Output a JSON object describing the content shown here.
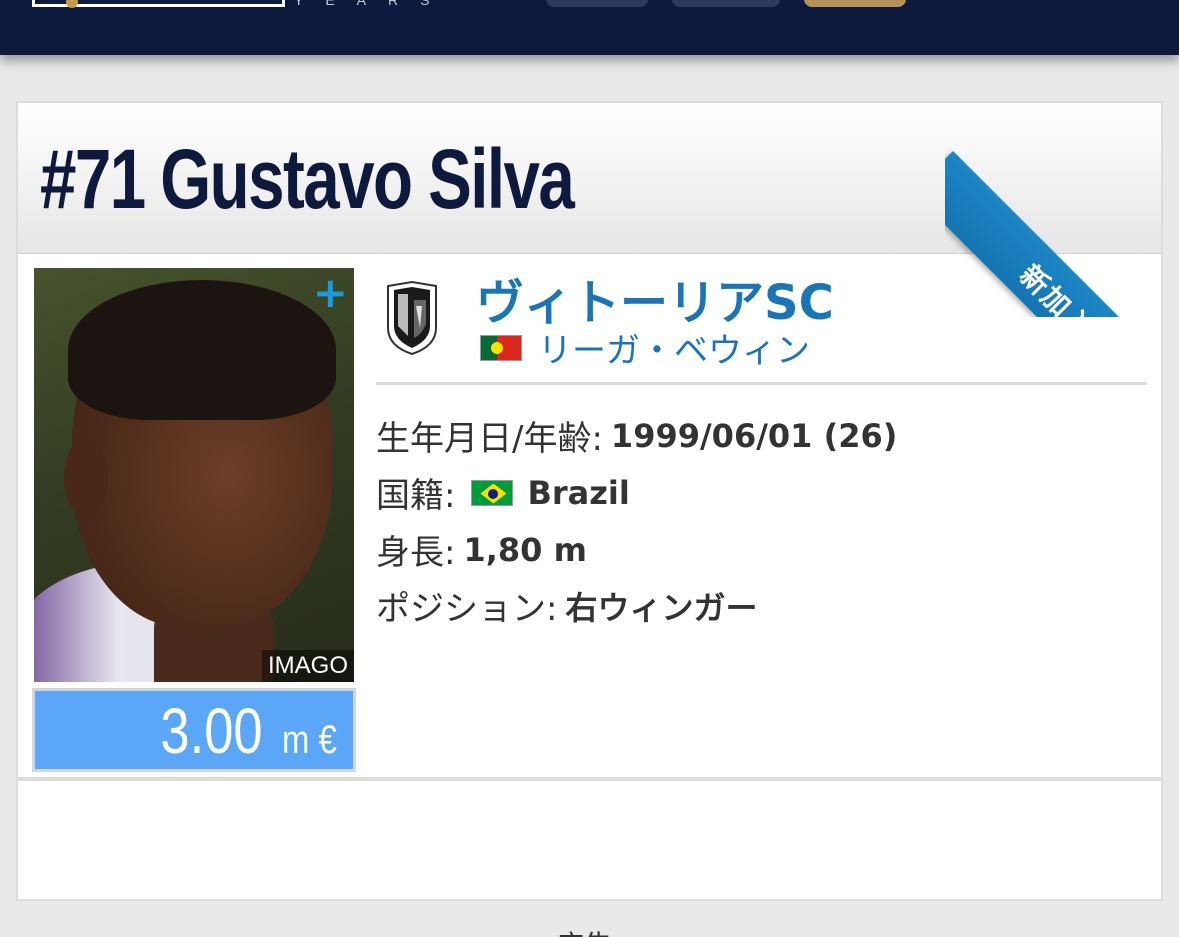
{
  "header": {
    "logo_years": "YEARS",
    "brand_gold": "#b59358",
    "brand_navy": "#0d1a3d"
  },
  "player": {
    "number": "#71",
    "name": "Gustavo Silva",
    "badge": "新加入",
    "photo_credit": "IMAGO",
    "photo_plus": "+",
    "market_value": "3.00",
    "market_value_unit": "m €"
  },
  "club": {
    "name": "ヴィトーリアSC",
    "league": "リーガ・ベウィン",
    "league_flag": "portugal-flag"
  },
  "details": {
    "birth_label": "生年月日/年齢:",
    "birth_value": "1999/06/01 (26)",
    "nationality_label": "国籍:",
    "nationality_flag": "brazil-flag",
    "nationality_value": "Brazil",
    "height_label": "身長:",
    "height_value": "1,80 m",
    "position_label": "ポジション:",
    "position_value": "右ウィンガー"
  },
  "footer": {
    "ad_label": "広告"
  },
  "colors": {
    "accent_blue": "#1a75b7",
    "ribbon_blue": "#1e86c6",
    "value_box": "#5ba6f7"
  }
}
